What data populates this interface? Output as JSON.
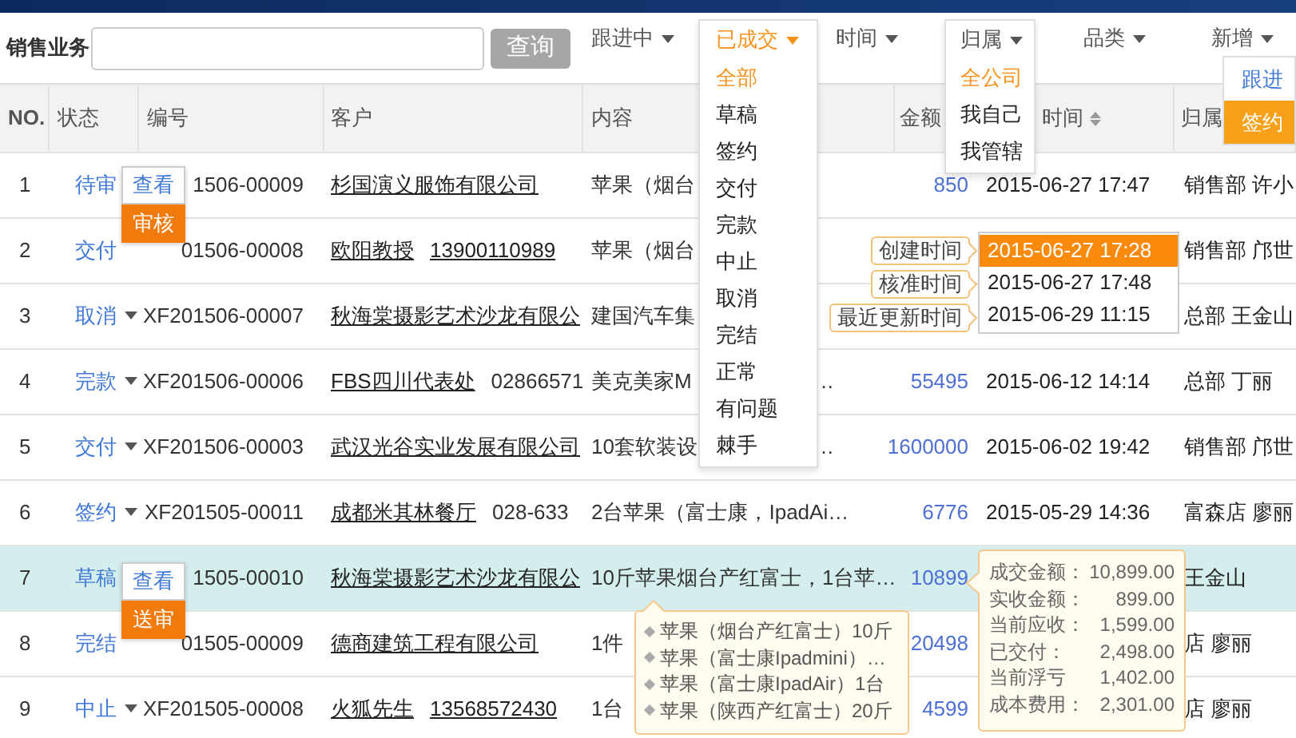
{
  "toolbar": {
    "label": "销售业务",
    "button": "查询"
  },
  "filters": [
    {
      "label": "跟进中",
      "kind": "filter",
      "active": false,
      "open": false
    },
    {
      "label": "已成交",
      "kind": "filter",
      "active": true,
      "open": true,
      "options": [
        {
          "label": "全部",
          "selected": true
        },
        {
          "label": "草稿",
          "selected": false
        },
        {
          "label": "签约",
          "selected": false
        },
        {
          "label": "交付",
          "selected": false
        },
        {
          "label": "完款",
          "selected": false
        },
        {
          "label": "中止",
          "selected": false
        },
        {
          "label": "取消",
          "selected": false
        },
        {
          "label": "完结",
          "selected": false
        },
        {
          "label": "正常",
          "selected": false
        },
        {
          "label": "有问题",
          "selected": false
        },
        {
          "label": "棘手",
          "selected": false
        }
      ]
    },
    {
      "label": "时间",
      "kind": "filter",
      "active": false,
      "open": false
    },
    {
      "label": "归属",
      "kind": "filter",
      "active": false,
      "open": true,
      "options": [
        {
          "label": "全公司",
          "selected": true
        },
        {
          "label": "我自己",
          "selected": false
        },
        {
          "label": "我管辖",
          "selected": false
        }
      ]
    },
    {
      "label": "品类",
      "kind": "filter",
      "active": false,
      "open": false
    },
    {
      "label": "新增",
      "kind": "action",
      "active": false,
      "open": true,
      "options": [
        {
          "label": "跟进",
          "selected": false
        },
        {
          "label": "签约",
          "selected": true
        }
      ]
    }
  ],
  "table": {
    "columns": [
      {
        "label": "NO.",
        "kind": "plain"
      },
      {
        "label": "状态",
        "kind": "plain"
      },
      {
        "label": "编号",
        "kind": "plain"
      },
      {
        "label": "客户",
        "kind": "plain"
      },
      {
        "label": "内容",
        "kind": "plain"
      },
      {
        "label": "金额",
        "kind": "plain"
      },
      {
        "label": "时间",
        "kind": "sortable"
      },
      {
        "label": "归属",
        "kind": "plain"
      }
    ],
    "rows": [
      {
        "no": "1",
        "status": "待审",
        "number": "1506-00009",
        "customer": "杉国演义服饰有限公司",
        "content": [
          "苹果（烟台"
        ],
        "amount": "850",
        "time": "2015-06-27 17:47",
        "owner": "销售部 许小",
        "selected": false,
        "actions": [
          {
            "label": "查看",
            "kind": "plain"
          },
          {
            "label": "审核",
            "kind": "primary"
          }
        ]
      },
      {
        "no": "2",
        "status": "交付",
        "number": "01506-00008",
        "customer": "欧阳教授",
        "phone": "13900110989",
        "phone_underlined": true,
        "content": [
          "苹果（烟台"
        ],
        "owner": "销售部 邝世",
        "selected": false,
        "time_popup": [
          {
            "label": "创建时间",
            "value": "2015-06-27 17:28",
            "selected": true
          },
          {
            "label": "核准时间",
            "value": "2015-06-27 17:48",
            "selected": false
          },
          {
            "label": "最近更新时间",
            "value": "2015-06-29 11:15",
            "selected": false
          }
        ]
      },
      {
        "no": "3",
        "status": "取消",
        "number": "XF201506-00007",
        "customer": "秋海棠摄影艺术沙龙有限公",
        "content": [
          "建国汽车集"
        ],
        "owner": "总部 王金山",
        "selected": false
      },
      {
        "no": "4",
        "status": "完款",
        "number": "XF201506-00006",
        "customer": "FBS四川代表处",
        "phone": "02866571",
        "phone_underlined": false,
        "content": [
          "美克美家M",
          "…"
        ],
        "amount": "55495",
        "time": "2015-06-12 14:14",
        "owner": "总部 丁丽",
        "selected": false
      },
      {
        "no": "5",
        "status": "交付",
        "number": "XF201506-00003",
        "customer": "武汉光谷实业发展有限公司",
        "content": [
          "10套软装设",
          "…"
        ],
        "amount": "1600000",
        "time": "2015-06-02 19:42",
        "owner": "销售部 邝世",
        "selected": false
      },
      {
        "no": "6",
        "status": "签约",
        "number": "XF201505-00011",
        "customer": "成都米其林餐厅",
        "phone": "028-633",
        "phone_underlined": false,
        "content": [
          "2台苹果（富士康，IpadAi…"
        ],
        "amount": "6776",
        "time": "2015-05-29 14:36",
        "owner": "富森店 廖丽",
        "selected": false
      },
      {
        "no": "7",
        "status": "草稿",
        "number": "1505-00010",
        "customer": "秋海棠摄影艺术沙龙有限公",
        "content": [
          "10斤苹果烟台产红富士，1台苹…"
        ],
        "amount": "10899",
        "owner": "王金山",
        "selected": true,
        "actions": [
          {
            "label": "查看",
            "kind": "plain"
          },
          {
            "label": "送审",
            "kind": "primary"
          }
        ],
        "content_popup": [
          "苹果（烟台产红富士）10斤",
          "苹果（富士康Ipadmini）…",
          "苹果（富士康IpadAir）1台",
          "苹果（陕西产红富士）20斤"
        ],
        "amount_popup": [
          {
            "label": "成交金额：",
            "value": "10,899.00"
          },
          {
            "label": "实收金额：",
            "value": "899.00"
          },
          {
            "label": "当前应收：",
            "value": "1,599.00"
          },
          {
            "label": "已交付：",
            "value": "2,498.00"
          },
          {
            "label": "当前浮亏",
            "value": "1,402.00"
          },
          {
            "label": "成本费用：",
            "value": "2,301.00"
          }
        ]
      },
      {
        "no": "8",
        "status": "完结",
        "number": "01505-00009",
        "customer": "德商建筑工程有限公司",
        "content": [
          "1件"
        ],
        "amount": "20498",
        "owner": "店 廖丽",
        "selected": false
      },
      {
        "no": "9",
        "status": "中止",
        "number": "XF201505-00008",
        "customer": "火狐先生",
        "phone": "13568572430",
        "phone_underlined": true,
        "content": [
          "1台"
        ],
        "amount": "4599",
        "owner": "店 廖丽",
        "selected": false
      }
    ]
  }
}
